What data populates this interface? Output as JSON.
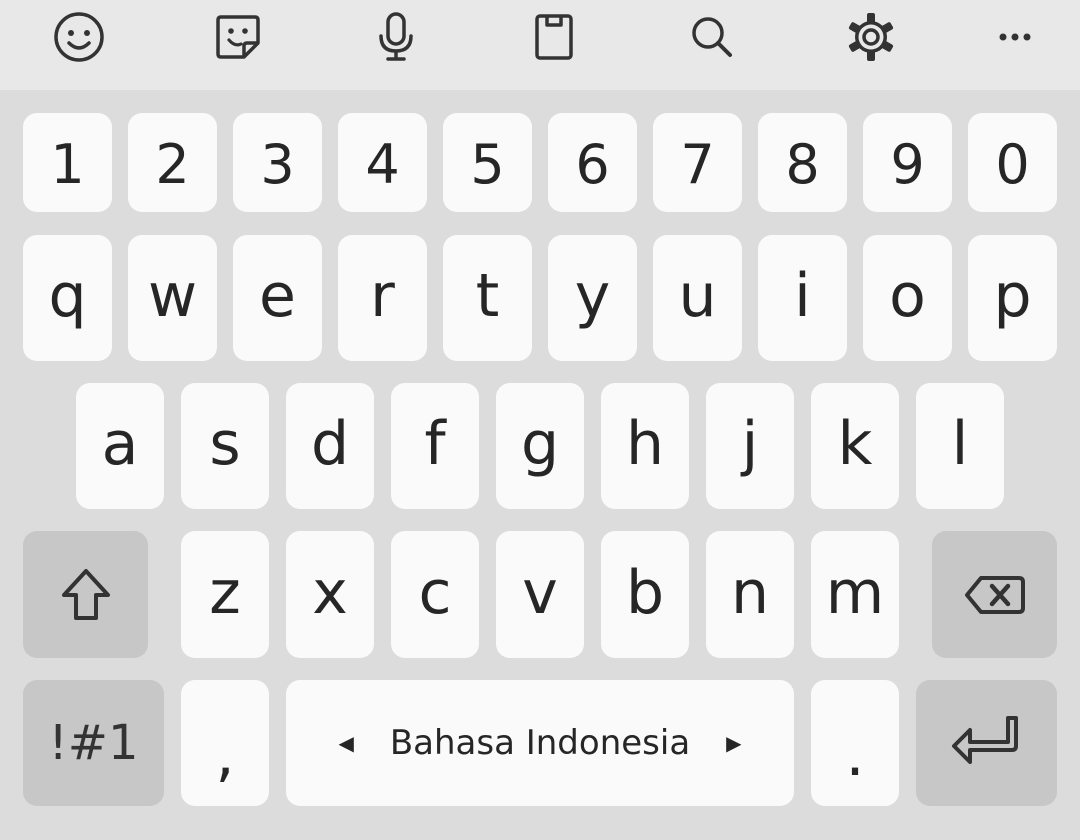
{
  "toolbar": {
    "icons": [
      {
        "name": "emoji-icon"
      },
      {
        "name": "sticker-icon"
      },
      {
        "name": "microphone-icon"
      },
      {
        "name": "clipboard-icon"
      },
      {
        "name": "search-icon"
      },
      {
        "name": "settings-icon"
      },
      {
        "name": "more-icon"
      }
    ]
  },
  "keyboard": {
    "number_row": [
      "1",
      "2",
      "3",
      "4",
      "5",
      "6",
      "7",
      "8",
      "9",
      "0"
    ],
    "row_top": [
      "q",
      "w",
      "e",
      "r",
      "t",
      "y",
      "u",
      "i",
      "o",
      "p"
    ],
    "row_middle": [
      "a",
      "s",
      "d",
      "f",
      "g",
      "h",
      "j",
      "k",
      "l"
    ],
    "row_bottom": [
      "z",
      "x",
      "c",
      "v",
      "b",
      "n",
      "m"
    ],
    "symbols_label": "!#1",
    "comma_label": ",",
    "space_label": "Bahasa Indonesia",
    "period_label": "."
  },
  "colors": {
    "keyboard_bg": "#dcdcdc",
    "toolbar_bg": "#e8e8e8",
    "key_bg": "#fafafa",
    "function_key_bg": "#c7c7c7",
    "text": "#262626"
  }
}
